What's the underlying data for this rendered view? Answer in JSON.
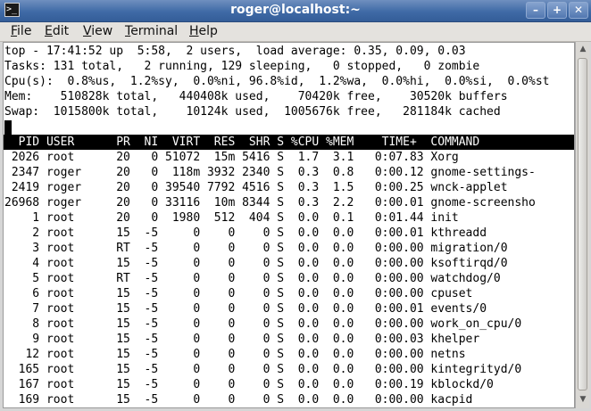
{
  "window": {
    "title": "roger@localhost:~",
    "icon_glyph": ">_"
  },
  "controls": {
    "minimize": "–",
    "maximize": "+",
    "close": "✕"
  },
  "menu": [
    {
      "label": "File",
      "mnemonic": "F"
    },
    {
      "label": "Edit",
      "mnemonic": "E"
    },
    {
      "label": "View",
      "mnemonic": "V"
    },
    {
      "label": "Terminal",
      "mnemonic": "T"
    },
    {
      "label": "Help",
      "mnemonic": "H"
    }
  ],
  "top": {
    "summary": [
      "top - 17:41:52 up  5:58,  2 users,  load average: 0.35, 0.09, 0.03",
      "Tasks: 131 total,   2 running, 129 sleeping,   0 stopped,   0 zombie",
      "Cpu(s):  0.8%us,  1.2%sy,  0.0%ni, 96.8%id,  1.2%wa,  0.0%hi,  0.0%si,  0.0%st",
      "Mem:    510828k total,   440408k used,    70420k free,    30520k buffers",
      "Swap:  1015800k total,    10124k used,  1005676k free,   281184k cached"
    ],
    "header": "  PID USER      PR  NI  VIRT  RES  SHR S %CPU %MEM    TIME+  COMMAND",
    "rows": [
      " 2026 root      20   0 51072  15m 5416 S  1.7  3.1   0:07.83 Xorg",
      " 2347 roger     20   0  118m 3932 2340 S  0.3  0.8   0:00.12 gnome-settings-",
      " 2419 roger     20   0 39540 7792 4516 S  0.3  1.5   0:00.25 wnck-applet",
      "26968 roger     20   0 33116  10m 8344 S  0.3  2.2   0:00.01 gnome-screensho",
      "    1 root      20   0  1980  512  404 S  0.0  0.1   0:01.44 init",
      "    2 root      15  -5     0    0    0 S  0.0  0.0   0:00.01 kthreadd",
      "    3 root      RT  -5     0    0    0 S  0.0  0.0   0:00.00 migration/0",
      "    4 root      15  -5     0    0    0 S  0.0  0.0   0:00.00 ksoftirqd/0",
      "    5 root      RT  -5     0    0    0 S  0.0  0.0   0:00.00 watchdog/0",
      "    6 root      15  -5     0    0    0 S  0.0  0.0   0:00.00 cpuset",
      "    7 root      15  -5     0    0    0 S  0.0  0.0   0:00.01 events/0",
      "    8 root      15  -5     0    0    0 S  0.0  0.0   0:00.00 work_on_cpu/0",
      "    9 root      15  -5     0    0    0 S  0.0  0.0   0:00.03 khelper",
      "   12 root      15  -5     0    0    0 S  0.0  0.0   0:00.00 netns",
      "  165 root      15  -5     0    0    0 S  0.0  0.0   0:00.00 kintegrityd/0",
      "  167 root      15  -5     0    0    0 S  0.0  0.0   0:00.19 kblockd/0",
      "  169 root      15  -5     0    0    0 S  0.0  0.0   0:00.00 kacpid"
    ]
  }
}
